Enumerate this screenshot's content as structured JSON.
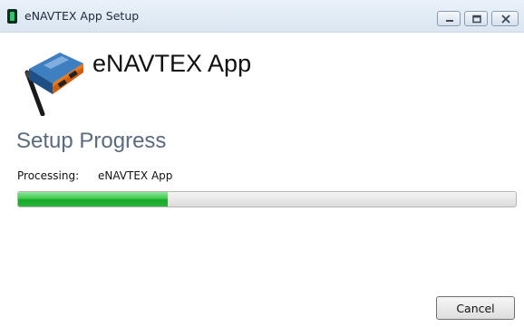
{
  "window": {
    "title": "eNAVTEX App Setup",
    "icon": "app-window-icon",
    "controls": [
      "minimize-icon",
      "maximize-icon",
      "close-icon"
    ]
  },
  "header": {
    "app_name": "eNAVTEX App",
    "logo": "device-with-antenna-logo"
  },
  "section": {
    "title": "Setup Progress"
  },
  "status": {
    "label": "Processing:",
    "value": "eNAVTEX App"
  },
  "progress": {
    "fraction": 0.3,
    "color": "#27b63a"
  },
  "buttons": {
    "cancel": "Cancel"
  }
}
